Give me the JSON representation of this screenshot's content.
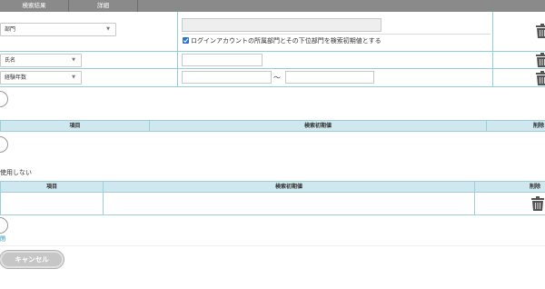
{
  "tabs": [
    {
      "label": "検索結果"
    },
    {
      "label": "詳細"
    }
  ],
  "conditions": {
    "department": {
      "select_label": "部門",
      "include_sub_checkbox_label": "ログインアカウントの所属部門とその下位部門を検索初期値とする",
      "include_sub_checked": true
    },
    "name": {
      "select_label": "氏名"
    },
    "experience": {
      "select_label": "経験年数",
      "range_separator": "～"
    }
  },
  "table1": {
    "headers": [
      "項目",
      "検索初期値",
      "削除"
    ]
  },
  "section2": {
    "caption": "使用しない"
  },
  "table2": {
    "headers": [
      "項目",
      "検索初期値",
      "削除"
    ]
  },
  "footer_link": "閉",
  "cancel_button": "キャンセル",
  "colors": {
    "tab_bg": "#8a8a8a",
    "row_border": "#8fd0d6",
    "table_header_bg": "#cfe8ef",
    "link": "#1a8fb0",
    "cancel_bg": "#c6c6c6"
  },
  "icons": [
    "caret-down-icon",
    "trash-icon",
    "circle-add-icon",
    "checkbox-icon"
  ]
}
